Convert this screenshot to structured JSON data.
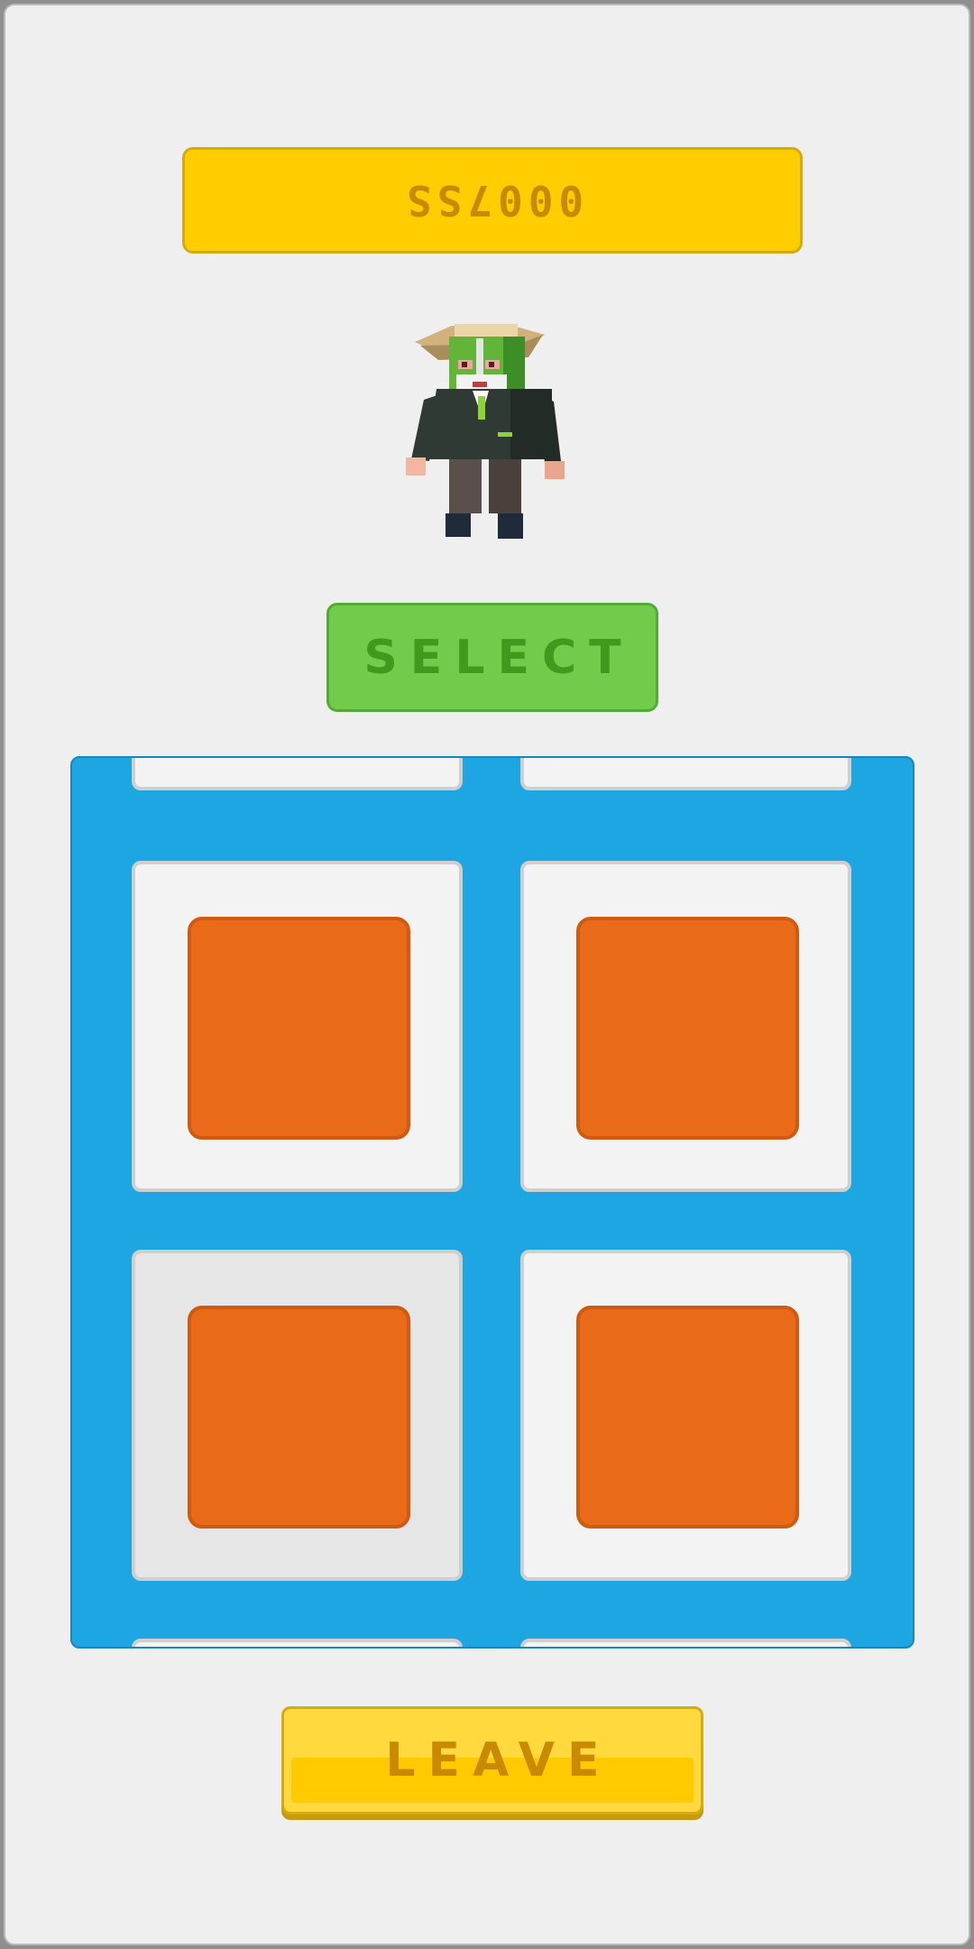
{
  "score": {
    "value": "0007SS"
  },
  "character": {
    "name_icon": "voxel-elder-character-icon"
  },
  "select": {
    "label": "SELECT"
  },
  "leave": {
    "label": "LEAVE"
  },
  "colors": {
    "score_bar": "#ffcd00",
    "select_button": "#70cc4a",
    "grid_panel": "#1ea6e2",
    "block": "#e96a19",
    "leave_button": "#ffd93d"
  }
}
